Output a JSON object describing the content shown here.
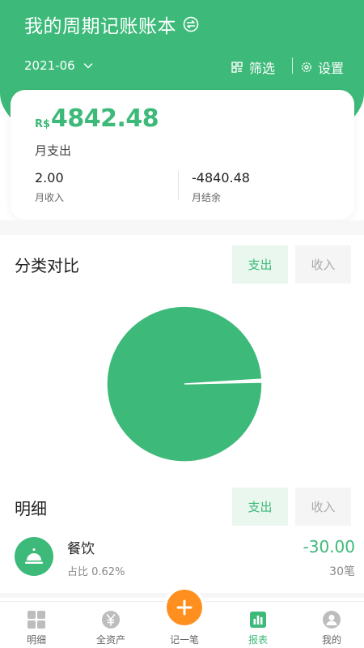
{
  "header": {
    "book_title": "我的周期记账账本",
    "month": "2021-06",
    "filter_label": "筛选",
    "settings_label": "设置"
  },
  "summary": {
    "currency": "R$",
    "monthly_expense": "4842.48",
    "monthly_expense_label": "月支出",
    "monthly_income": "2.00",
    "monthly_income_label": "月收入",
    "monthly_balance": "-4840.48",
    "monthly_balance_label": "月结余"
  },
  "compare": {
    "title": "分类对比",
    "expense_tab": "支出",
    "income_tab": "收入"
  },
  "chart_data": {
    "type": "pie",
    "slices": [
      {
        "name": "餐饮",
        "value": 0.62
      },
      {
        "value": 99.38
      }
    ],
    "colors": [
      "#ffffff",
      "#3dba79"
    ]
  },
  "details": {
    "title": "明细",
    "expense_tab": "支出",
    "income_tab": "收入",
    "items": [
      {
        "icon": "dining-bell-icon",
        "name": "餐饮",
        "share": "占比 0.62%",
        "amount": "-30.00",
        "count": "30笔"
      }
    ]
  },
  "tabbar": {
    "items": [
      {
        "label": "明细",
        "icon": "grid-icon"
      },
      {
        "label": "全资产",
        "icon": "yuan-icon"
      },
      {
        "label": "记一笔",
        "icon": "plus-icon"
      },
      {
        "label": "报表",
        "icon": "report-icon"
      },
      {
        "label": "我的",
        "icon": "person-icon"
      }
    ],
    "active": "报表"
  },
  "colors": {
    "accent": "#3dba79",
    "add_button": "#ff8f1f"
  }
}
